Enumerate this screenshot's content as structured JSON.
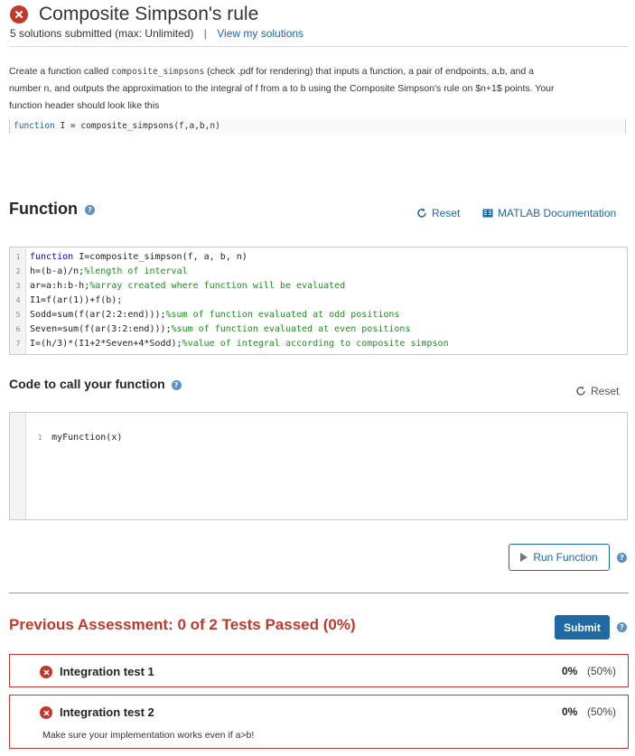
{
  "header": {
    "title": "Composite Simpson's rule",
    "submitted": "5 solutions submitted (max: Unlimited)",
    "separator": "|",
    "view_solutions": "View my solutions"
  },
  "description": {
    "part1": "Create a function called",
    "func_name": "composite_simpsons",
    "part2": "(check .pdf for rendering) that inputs a function, a pair of endpoints, a,b, and a",
    "line2": "number n, and outputs the approximation to the integral of f from a to b using the Composite Simpson's rule on $n+1$ points. Your",
    "line3": "function header should look like this",
    "header_kw": "function",
    "header_rest": " I = composite_simpsons(f,a,b,n)"
  },
  "function_section": {
    "title": "Function",
    "reset_label": "Reset",
    "docs_label": "MATLAB Documentation",
    "lines": [
      {
        "num": "1",
        "kw": "function",
        "code": " I=composite_simpson(f, a, b, n)",
        "comment": ""
      },
      {
        "num": "2",
        "kw": "",
        "code": "h=(b-a)/n;",
        "comment": "%length of interval"
      },
      {
        "num": "3",
        "kw": "",
        "code": "ar=a:h:b-h;",
        "comment": "%array created where function will be evaluated"
      },
      {
        "num": "4",
        "kw": "",
        "code": "I1=f(ar(1))+f(b);",
        "comment": ""
      },
      {
        "num": "5",
        "kw": "",
        "code": "Sodd=sum(f(ar(2:2:end)));",
        "comment": "%sum of function evaluated at odd positions"
      },
      {
        "num": "6",
        "kw": "",
        "code": "Seven=sum(f(ar(3:2:end)));",
        "comment": "%sum of function evaluated at even positions"
      },
      {
        "num": "7",
        "kw": "",
        "code": "I=(h/3)*(I1+2*Seven+4*Sodd);",
        "comment": "%value of integral according to composite simpson"
      }
    ]
  },
  "call_section": {
    "title": "Code to call your function",
    "reset_label": "Reset",
    "line_num": "1",
    "code": "myFunction(x)"
  },
  "run_button": "Run Function",
  "assessment": {
    "title": "Previous Assessment: 0 of 2 Tests Passed (0%)",
    "submit_label": "Submit",
    "tests": [
      {
        "name": "Integration test 1",
        "percent": "0%",
        "weight": "(50%)",
        "message": ""
      },
      {
        "name": "Integration test 2",
        "percent": "0%",
        "weight": "(50%)",
        "message": "Make sure your implementation works even if a>b!"
      }
    ]
  },
  "colors": {
    "fail_red": "#c0392b",
    "link_blue": "#1a66b0",
    "submit_blue": "#1f6aa5",
    "comment_green": "#228b22"
  }
}
